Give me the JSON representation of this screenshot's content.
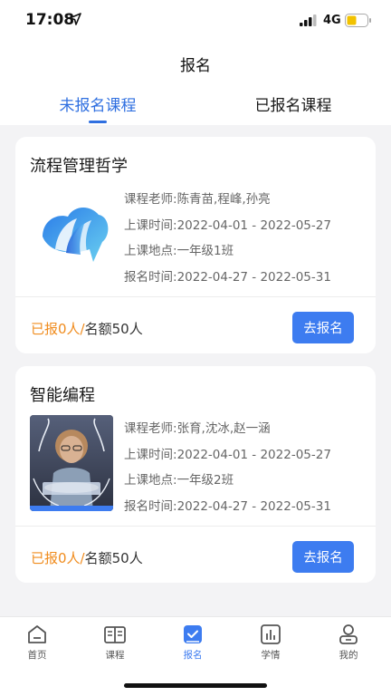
{
  "status_bar": {
    "time": "17:08",
    "network": "4G",
    "battery_color": "#f2c200"
  },
  "nav": {
    "title": "报名"
  },
  "tabs": [
    {
      "label": "未报名课程",
      "active": true
    },
    {
      "label": "已报名课程",
      "active": false
    }
  ],
  "courses": [
    {
      "title": "流程管理哲学",
      "thumbnail": "cloud-logo",
      "teacher_label": "课程老师:",
      "teacher": "陈青苗,程峰,孙亮",
      "class_time_label": "上课时间:",
      "class_time": "2022-04-01 - 2022-05-27",
      "location_label": "上课地点:",
      "location": "一年级1班",
      "enroll_time_label": "报名时间:",
      "enroll_time": "2022-04-27 - 2022-05-31",
      "taken": "已报0人/",
      "total": "名额50人",
      "button": "去报名"
    },
    {
      "title": "智能编程",
      "thumbnail": "child-coding-photo",
      "teacher_label": "课程老师:",
      "teacher": "张育,沈冰,赵一涵",
      "class_time_label": "上课时间:",
      "class_time": "2022-04-01 - 2022-05-27",
      "location_label": "上课地点:",
      "location": "一年级2班",
      "enroll_time_label": "报名时间:",
      "enroll_time": "2022-04-27 - 2022-05-31",
      "taken": "已报0人/",
      "total": "名额50人",
      "button": "去报名"
    }
  ],
  "tabbar": [
    {
      "label": "首页",
      "icon": "home-icon",
      "active": false
    },
    {
      "label": "课程",
      "icon": "book-icon",
      "active": false
    },
    {
      "label": "报名",
      "icon": "checkbox-icon",
      "active": true
    },
    {
      "label": "学情",
      "icon": "bar-chart-icon",
      "active": false
    },
    {
      "label": "我的",
      "icon": "user-icon",
      "active": false
    }
  ],
  "colors": {
    "accent": "#3d7cf0",
    "tab_active": "#2f6fe0",
    "quota_taken": "#f08c1e"
  }
}
